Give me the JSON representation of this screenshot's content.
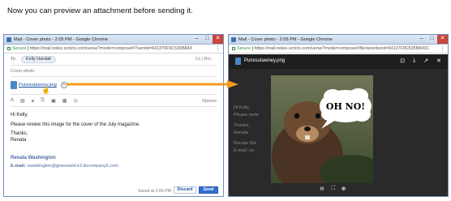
{
  "caption": "Now you can preview an attachment before sending it.",
  "window_title": "Mail - Cover photo - 2:05 PM - Google Chrome",
  "url_secure_label": "Secure",
  "url_left": "https://mail.notes.scniris.com/verse?mode=compose#/?sentid=641370F9C535B843",
  "url_right": "https://mail.notes.scniris.com/verse?mode=compose#/fileview/docid=64137F9C535B843C",
  "compose": {
    "to_label": "To",
    "to_recipient": "Kelly Hardatt",
    "cc_label": "Cc | Bcc",
    "subject": "Cover photo",
    "attachment_name": "Punxsutawney.png",
    "options_label": "Options",
    "body_lines": [
      "Hi Kelly,",
      "",
      "Please review this image for the cover of the July magazine.",
      "",
      "Thanks,",
      "Renata"
    ],
    "signature_name": "Renata Washington",
    "signature_email_label": "E-mail:",
    "signature_email": "rwashington@greenwell.ir3.llncompany5.com",
    "saved_text": "Saved at 2:05 PM",
    "discard_label": "Discard",
    "send_label": "Send"
  },
  "preview": {
    "file_name": "Punxsutawney.png",
    "bubble_text": "OH NO!",
    "bg_lines": [
      "Hi Kelly,",
      "Please revie",
      "Thanks,",
      "Renata",
      "Renata Wa",
      "E-mail: rw"
    ]
  },
  "colors": {
    "accent": "#2f6fd0",
    "arrow": "#f39a1e",
    "close": "#c9463d"
  }
}
